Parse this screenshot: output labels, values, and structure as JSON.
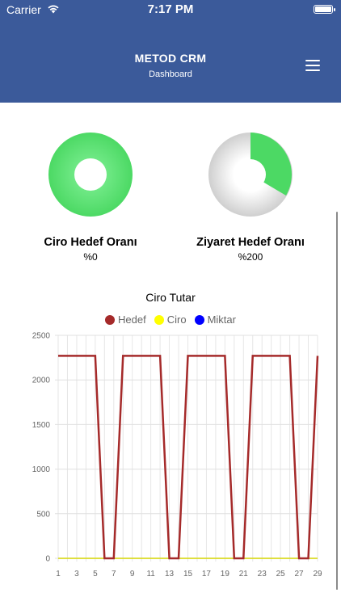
{
  "status_bar": {
    "carrier": "Carrier",
    "time": "7:17 PM"
  },
  "header": {
    "title": "METOD CRM",
    "subtitle": "Dashboard"
  },
  "gauges": [
    {
      "label": "Ciro Hedef Oranı",
      "value": "%0",
      "color": "#4cd964"
    },
    {
      "label": "Ziyaret Hedef Oranı",
      "value": "%200",
      "color": "#4cd964"
    }
  ],
  "colors": {
    "header_bg": "#3b5a9a",
    "gauge_green": "#4cd964",
    "gauge_gray": "#d9d9d9"
  },
  "chart_data": {
    "type": "line",
    "title": "Ciro Tutar",
    "x": [
      1,
      2,
      3,
      4,
      5,
      6,
      7,
      8,
      9,
      10,
      11,
      12,
      13,
      14,
      15,
      16,
      17,
      18,
      19,
      20,
      21,
      22,
      23,
      24,
      25,
      26,
      27,
      28,
      29
    ],
    "x_tick_labels": [
      "1",
      "3",
      "5",
      "7",
      "9",
      "11",
      "13",
      "15",
      "17",
      "19",
      "21",
      "23",
      "25",
      "27",
      "29"
    ],
    "ylim": [
      0,
      2500
    ],
    "y_tick_labels": [
      "0",
      "500",
      "1000",
      "1500",
      "2000",
      "2500"
    ],
    "grid": true,
    "legend_position": "top",
    "series": [
      {
        "name": "Hedef",
        "color": "#a52a2a",
        "values": [
          2270,
          2270,
          2270,
          2270,
          2270,
          0,
          0,
          2270,
          2270,
          2270,
          2270,
          2270,
          0,
          0,
          2270,
          2270,
          2270,
          2270,
          2270,
          0,
          0,
          2270,
          2270,
          2270,
          2270,
          2270,
          0,
          0,
          2270
        ]
      },
      {
        "name": "Ciro",
        "color": "#ffff00",
        "values": [
          0,
          0,
          0,
          0,
          0,
          0,
          0,
          0,
          0,
          0,
          0,
          0,
          0,
          0,
          0,
          0,
          0,
          0,
          0,
          0,
          0,
          0,
          0,
          0,
          0,
          0,
          0,
          0,
          0
        ]
      },
      {
        "name": "Miktar",
        "color": "#0000ff",
        "values": [
          0,
          0,
          0,
          0,
          0,
          0,
          0,
          0,
          0,
          0,
          0,
          0,
          0,
          0,
          0,
          0,
          0,
          0,
          0,
          0,
          0,
          0,
          0,
          0,
          0,
          0,
          0,
          0,
          0
        ]
      }
    ]
  }
}
